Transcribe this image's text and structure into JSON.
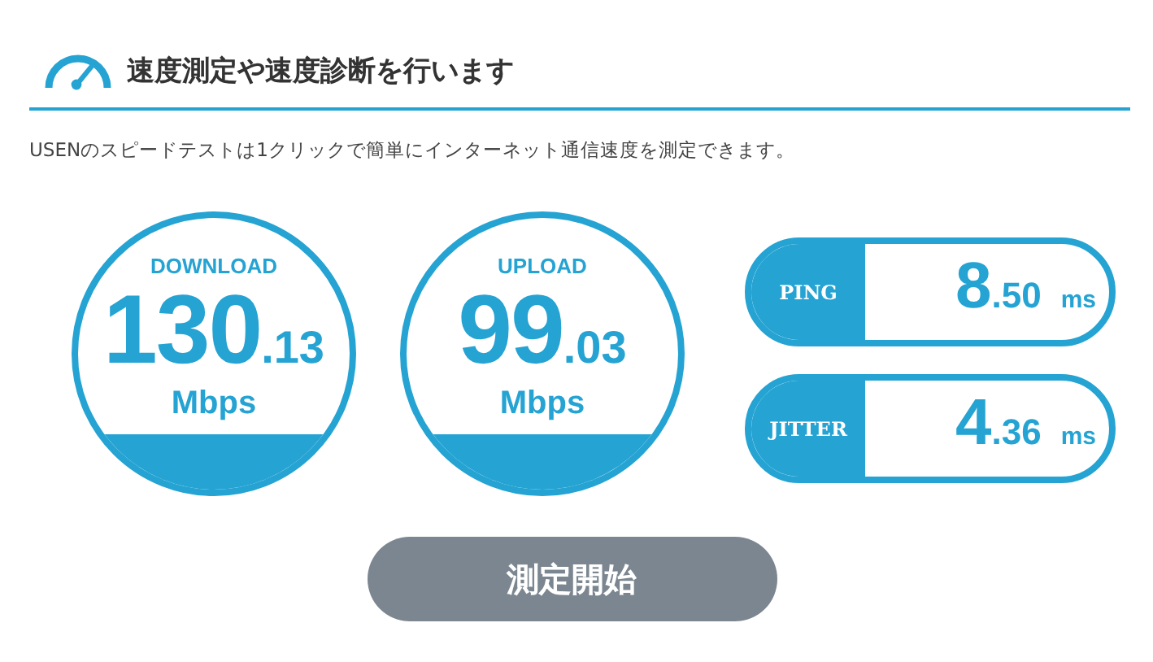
{
  "header": {
    "title": "速度測定や速度診断を行います"
  },
  "description": "USENのスピードテストは1クリックで簡単にインターネット通信速度を測定できます。",
  "gauges": [
    {
      "label": "DOWNLOAD",
      "integer": "130",
      "decimal": ".13",
      "unit": "Mbps"
    },
    {
      "label": "UPLOAD",
      "integer": "99",
      "decimal": ".03",
      "unit": "Mbps"
    }
  ],
  "metrics": [
    {
      "label": "PING",
      "integer": "8",
      "decimal": ".50",
      "unit": "ms"
    },
    {
      "label": "JITTER",
      "integer": "4",
      "decimal": ".36",
      "unit": "ms"
    }
  ],
  "start_button": "測定開始"
}
